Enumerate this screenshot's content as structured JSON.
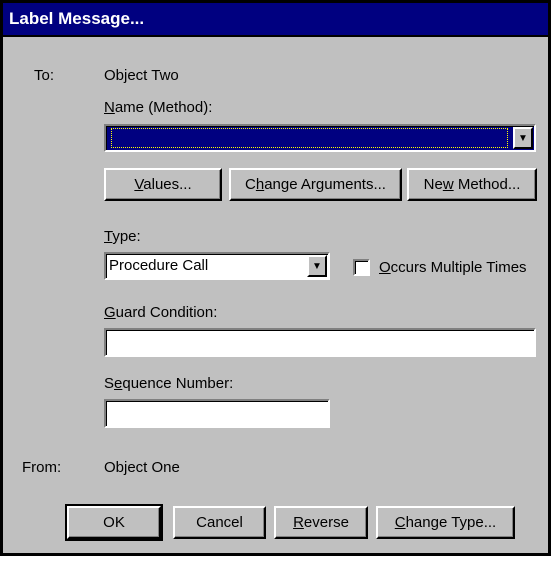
{
  "dialog": {
    "title": "Label Message..."
  },
  "to": {
    "label": "To:",
    "value": "Object Two"
  },
  "name_method": {
    "label_prefix": "N",
    "label_rest": "ame (Method):",
    "value": ""
  },
  "buttons": {
    "values_u": "V",
    "values_rest": "alues...",
    "change_args_pre": "C",
    "change_args_u": "h",
    "change_args_rest": "ange Arguments...",
    "new_method_pre": "Ne",
    "new_method_u": "w",
    "new_method_rest": " Method..."
  },
  "type": {
    "label_u": "T",
    "label_rest": "ype:",
    "value": "Procedure Call"
  },
  "occurs": {
    "label_u": "O",
    "label_rest": "ccurs Multiple Times",
    "checked": false
  },
  "guard": {
    "label_u": "G",
    "label_rest": "uard Condition:",
    "value": ""
  },
  "sequence": {
    "label_pre": "S",
    "label_u": "e",
    "label_rest": "quence Number:",
    "value": ""
  },
  "from": {
    "label": "From:",
    "value": "Object One"
  },
  "footer": {
    "ok": "OK",
    "cancel": "Cancel",
    "reverse_u": "R",
    "reverse_rest": "everse",
    "change_type_u": "C",
    "change_type_rest": "hange Type..."
  },
  "colors": {
    "titlebar": "#000080",
    "dialog_bg": "#c0c0c0",
    "selection": "#000080"
  }
}
